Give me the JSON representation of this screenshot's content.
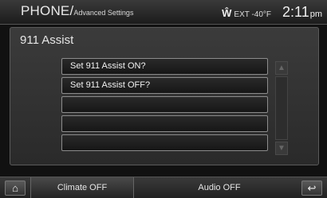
{
  "header": {
    "title": "PHONE/",
    "subtitle": "Advanced Settings",
    "wifi_glyph": "Ŵ",
    "temperature": "EXT -40°F",
    "time": "2:11",
    "ampm": "pm"
  },
  "panel": {
    "title": "911 Assist",
    "items": [
      {
        "label": "Set 911 Assist ON?"
      },
      {
        "label": "Set 911 Assist OFF?"
      },
      {
        "label": ""
      },
      {
        "label": ""
      },
      {
        "label": ""
      }
    ]
  },
  "scroll": {
    "up_glyph": "▲",
    "down_glyph": "▼"
  },
  "bottom": {
    "home_glyph": "⌂",
    "climate_label": "Climate OFF",
    "audio_label": "Audio OFF",
    "back_glyph": "↩"
  },
  "icons": {
    "home": "home-icon",
    "back": "back-icon",
    "wifi": "wifi-icon"
  }
}
